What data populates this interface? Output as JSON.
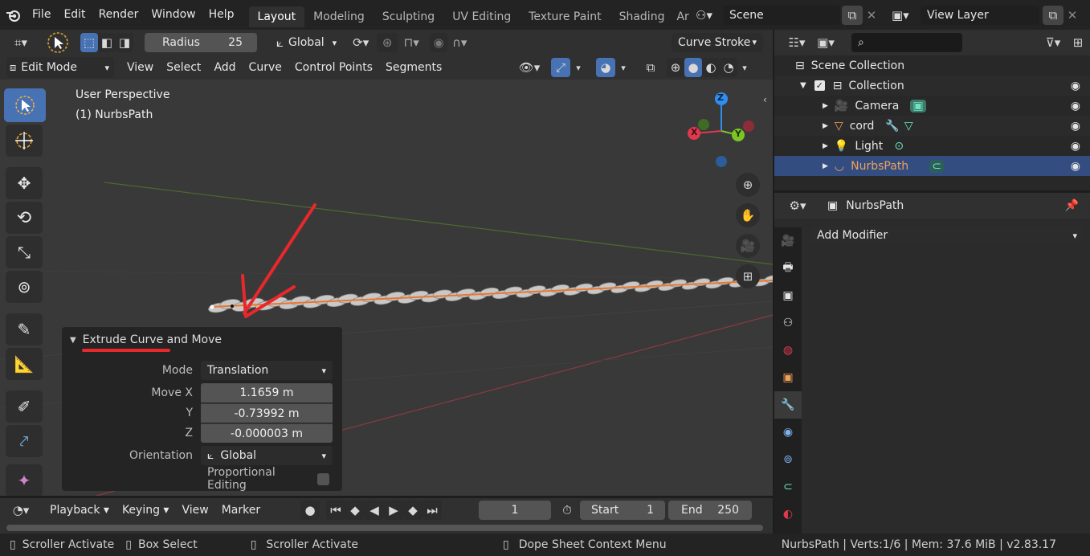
{
  "topbar": {
    "menus": [
      "File",
      "Edit",
      "Render",
      "Window",
      "Help"
    ],
    "workspace_tabs": [
      "Layout",
      "Modeling",
      "Sculpting",
      "UV Editing",
      "Texture Paint",
      "Shading",
      "Ar"
    ],
    "active_tab": "Layout",
    "scene": "Scene",
    "view_layer": "View Layer"
  },
  "viewport_header": {
    "radius_label": "Radius",
    "radius_value": "25",
    "transform_orientation": "Global",
    "curve_stroke": "Curve Stroke",
    "mode": "Edit Mode",
    "menus": [
      "View",
      "Select",
      "Add",
      "Curve",
      "Control Points",
      "Segments"
    ]
  },
  "viewport": {
    "perspective": "User Perspective",
    "object": "(1) NurbsPath",
    "gizmo_axes": [
      "X",
      "Y",
      "Z"
    ]
  },
  "operator_panel": {
    "title": "Extrude Curve and Move",
    "mode_label": "Mode",
    "mode_value": "Translation",
    "move_x_label": "Move X",
    "move_x": "1.1659 m",
    "y_label": "Y",
    "move_y": "-0.73992 m",
    "z_label": "Z",
    "move_z": "-0.000003 m",
    "orientation_label": "Orientation",
    "orientation_value": "Global",
    "proportional_label": "Proportional Editing"
  },
  "timeline": {
    "menus": [
      "Playback",
      "Keying",
      "View",
      "Marker"
    ],
    "current_frame": "1",
    "start_label": "Start",
    "start": "1",
    "end_label": "End",
    "end": "250"
  },
  "outliner": {
    "root": "Scene Collection",
    "collection": "Collection",
    "items": [
      "Camera",
      "cord",
      "Light",
      "NurbsPath"
    ],
    "selected": "NurbsPath"
  },
  "properties": {
    "object_name": "NurbsPath",
    "add_modifier": "Add Modifier"
  },
  "statusbar": {
    "left1": "Scroller Activate",
    "left2": "Box Select",
    "mid": "Scroller Activate",
    "context": "Dope Sheet Context Menu",
    "info": "NurbsPath | Verts:1/6 | Mem: 37.6 MiB | v2.83.17"
  },
  "colors": {
    "accent": "#4772b3",
    "selected_row": "#334d80",
    "orange": "#f0a15a",
    "axis_x": "#e0394e",
    "axis_y": "#7bc624",
    "axis_z": "#2f8ff0",
    "annotation": "#e8282a"
  }
}
